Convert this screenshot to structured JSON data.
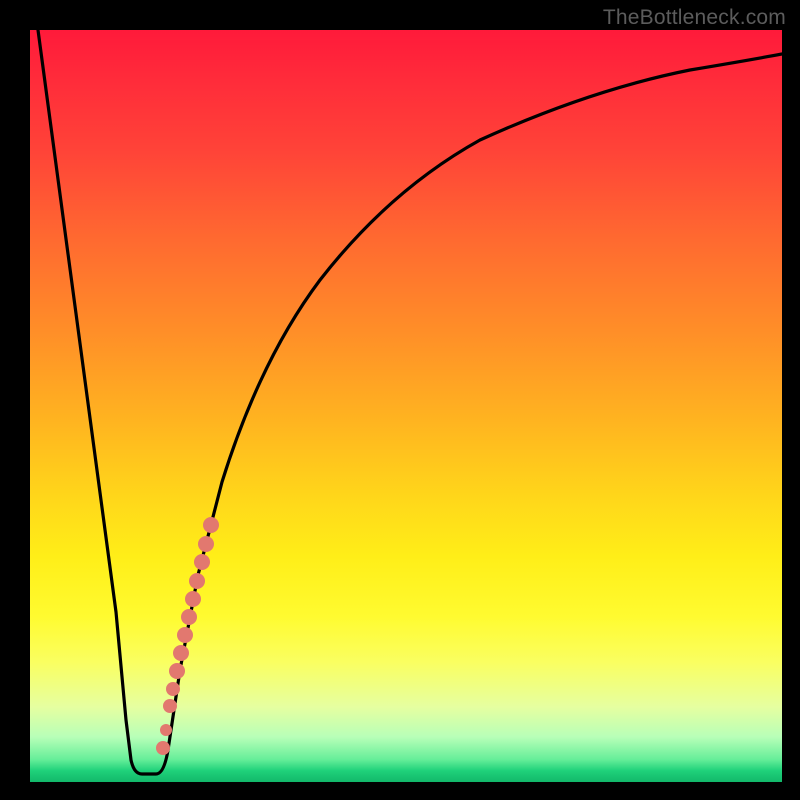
{
  "watermark": "TheBottleneck.com",
  "colors": {
    "frame": "#000000",
    "curve": "#000000",
    "dots": "#e2786f",
    "gradient_top": "#ff1a3a",
    "gradient_bottom": "#12b86a"
  },
  "chart_data": {
    "type": "line",
    "title": "",
    "xlabel": "",
    "ylabel": "",
    "xlim": [
      0,
      100
    ],
    "ylim": [
      0,
      100
    ],
    "grid": false,
    "legend": false,
    "annotations": [
      "TheBottleneck.com"
    ],
    "series": [
      {
        "name": "bottleneck-curve",
        "x": [
          0,
          2,
          4,
          6,
          8,
          10,
          11,
          12,
          13,
          14,
          15,
          16,
          17,
          18,
          19,
          20,
          22,
          24,
          26,
          28,
          30,
          33,
          36,
          40,
          45,
          50,
          56,
          63,
          72,
          82,
          92,
          100
        ],
        "y": [
          100,
          88,
          76,
          64,
          52,
          30,
          15,
          4,
          1,
          1,
          1,
          1,
          2,
          4,
          8,
          13,
          22,
          30,
          38,
          45,
          51,
          58,
          64,
          70,
          76,
          80,
          84,
          88,
          91,
          93,
          95,
          96
        ]
      }
    ],
    "points": [
      {
        "x": 17.0,
        "y": 4.5
      },
      {
        "x": 17.6,
        "y": 8.0
      },
      {
        "x": 18.2,
        "y": 11.0
      },
      {
        "x": 18.8,
        "y": 13.5
      },
      {
        "x": 19.4,
        "y": 16.0
      },
      {
        "x": 20.0,
        "y": 18.5
      },
      {
        "x": 20.6,
        "y": 21.0
      },
      {
        "x": 21.2,
        "y": 23.5
      },
      {
        "x": 21.8,
        "y": 26.0
      },
      {
        "x": 22.4,
        "y": 28.5
      },
      {
        "x": 23.0,
        "y": 31.0
      },
      {
        "x": 23.6,
        "y": 33.5
      },
      {
        "x": 24.2,
        "y": 36.0
      }
    ]
  }
}
